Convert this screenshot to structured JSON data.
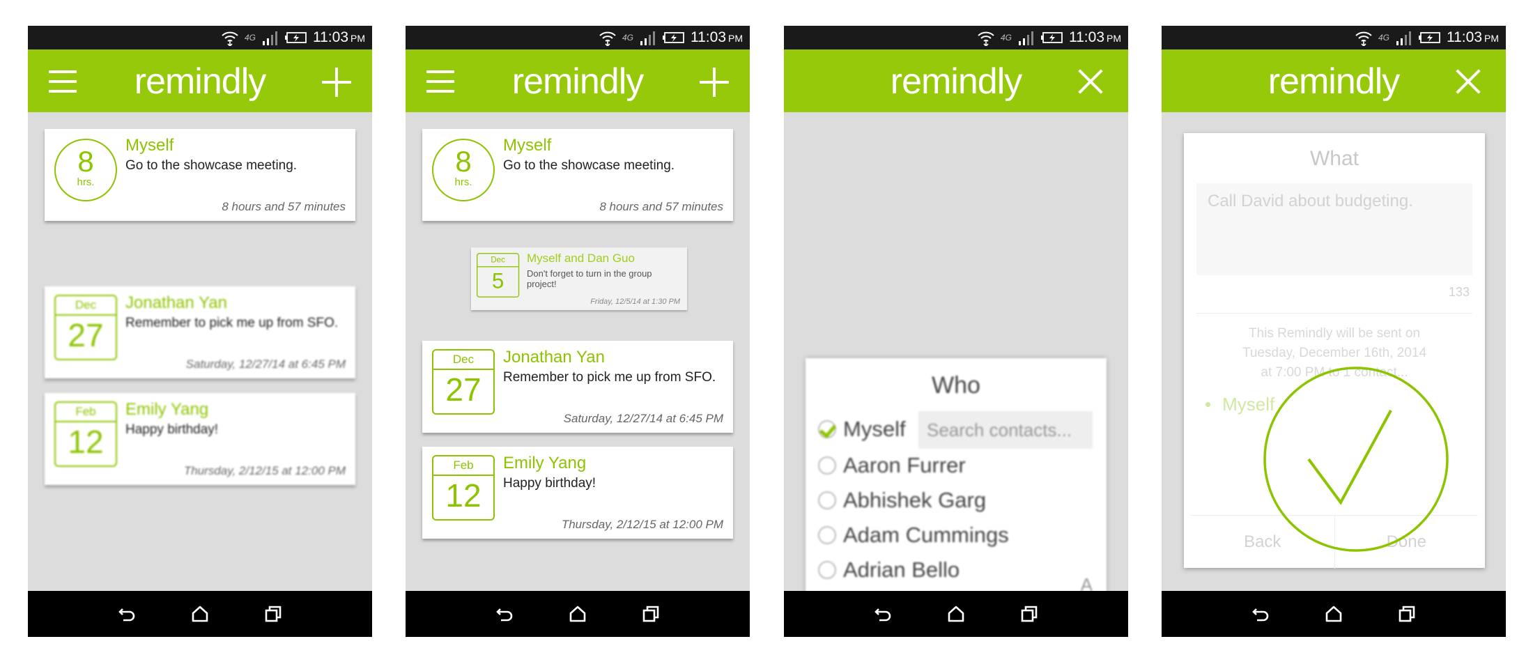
{
  "status": {
    "network": "4G",
    "time": "11:03",
    "ampm": "PM"
  },
  "app": {
    "title": "remindly",
    "accent": "#97c90b"
  },
  "screen1": {
    "cards": [
      {
        "who": "Myself",
        "message": "Go to the showcase meeting.",
        "badge_number": "8",
        "badge_unit": "hrs.",
        "when": "8 hours and 57 minutes"
      },
      {
        "who": "Jonathan Yan",
        "message": "Remember to pick me up from SFO.",
        "month": "Dec",
        "day": "27",
        "when": "Saturday, 12/27/14 at 6:45 PM"
      },
      {
        "who": "Emily Yang",
        "message": "Happy birthday!",
        "month": "Feb",
        "day": "12",
        "when": "Thursday, 2/12/15 at 12:00 PM"
      }
    ]
  },
  "screen2": {
    "cards": [
      {
        "who": "Myself",
        "message": "Go to the showcase meeting.",
        "badge_number": "8",
        "badge_unit": "hrs.",
        "when": "8 hours and 57 minutes"
      },
      {
        "who": "Myself and Dan Guo",
        "message": "Don't forget to turn in the group project!",
        "month": "Dec",
        "day": "5",
        "when": "Friday, 12/5/14 at 1:30 PM"
      },
      {
        "who": "Jonathan Yan",
        "message": "Remember to pick me up from SFO.",
        "month": "Dec",
        "day": "27",
        "when": "Saturday, 12/27/14 at 6:45 PM"
      },
      {
        "who": "Emily Yang",
        "message": "Happy birthday!",
        "month": "Feb",
        "day": "12",
        "when": "Thursday, 2/12/15 at 12:00 PM"
      }
    ]
  },
  "screen3": {
    "title": "Who",
    "search_placeholder": "Search contacts...",
    "contacts": [
      "Myself",
      "Aaron Furrer",
      "Abhishek Garg",
      "Adam Cummings",
      "Adrian Bello"
    ],
    "index_letter": "A"
  },
  "screen4": {
    "heading": "What",
    "message": "Call David about budgeting.",
    "char_count": "133",
    "info_line1": "This Remindly will be sent on",
    "info_line2": "Tuesday, December 16th, 2014",
    "info_line3": "at 7:00 PM to 1 contact...",
    "recipient": "Myself",
    "back_label": "Back",
    "done_label": "Done"
  }
}
